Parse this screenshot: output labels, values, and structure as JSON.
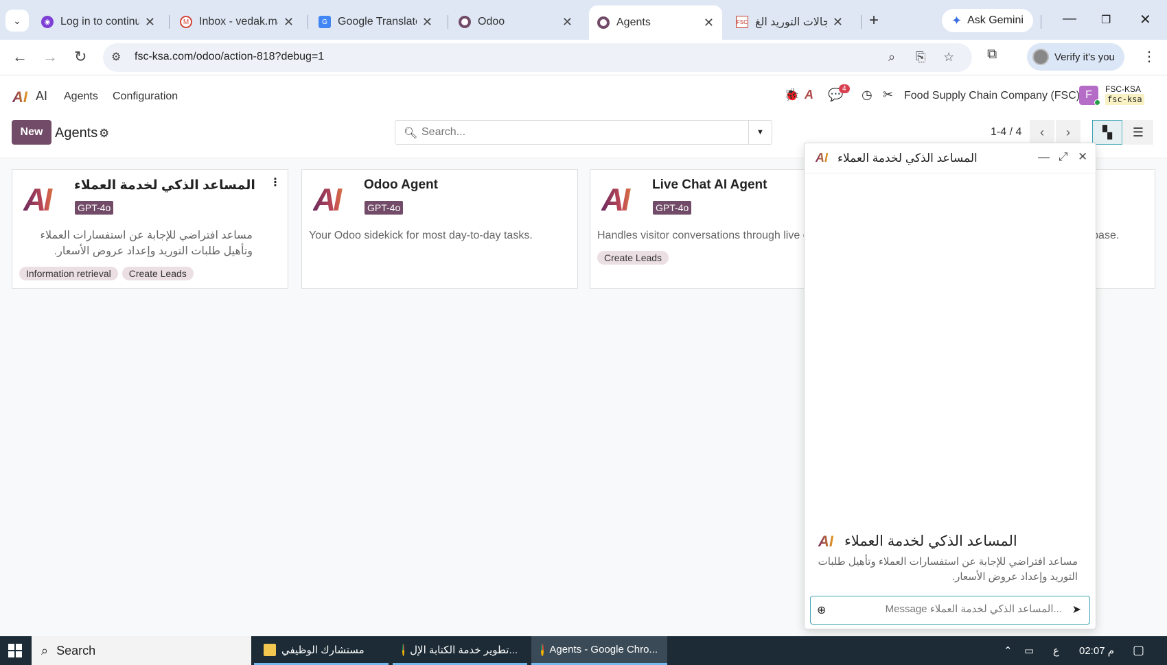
{
  "browser": {
    "tabs": [
      {
        "label": "Log in to continu",
        "icon": "security-icon",
        "color": "#7e3fd6"
      },
      {
        "label": "Inbox - vedak.ma",
        "icon": "mail-icon",
        "color": "#d44638"
      },
      {
        "label": "Google Translate",
        "icon": "translate-icon",
        "color": "#4285f4"
      },
      {
        "label": "Odoo",
        "icon": "odoo-icon",
        "color": "#714b67"
      },
      {
        "label": "Agents",
        "icon": "odoo-icon",
        "color": "#714b67"
      },
      {
        "label": "مجالات التوريد الغ",
        "icon": "page-icon",
        "color": "#c0392b"
      }
    ],
    "gemini_label": "Ask Gemini",
    "url": "fsc-ksa.com/odoo/action-818?debug=1",
    "verify_label": "Verify it's you"
  },
  "odoo": {
    "app_logo": "AI",
    "app_name": "AI",
    "menu": [
      "Agents",
      "Configuration"
    ],
    "message_count": "4",
    "company": "Food Supply Chain Company (FSC)",
    "user_initial": "F",
    "db_name": "FSC-KSA",
    "db_code": "fsc-ksa"
  },
  "control_panel": {
    "new_label": "New",
    "title": "Agents",
    "search_placeholder": "Search...",
    "pager": "1-4 / 4"
  },
  "agents": [
    {
      "name": "المساعد الذكي لخدمة العملاء",
      "model": "GPT-4o",
      "description": "مساعد افتراضي للإجابة عن استفسارات العملاء وتأهيل طلبات التوريد وإعداد عروض الأسعار.",
      "tags": [
        "Information retrieval",
        "Create Leads"
      ]
    },
    {
      "name": "Odoo Agent",
      "model": "GPT-4o",
      "description": "Your Odoo sidekick for most day-to-day tasks.",
      "tags": []
    },
    {
      "name": "Live Chat AI Agent",
      "model": "GPT-4o",
      "description": "Handles visitor conversations through live c",
      "tags": [
        "Create Leads"
      ]
    },
    {
      "name": "",
      "model": "",
      "description": "database.",
      "tags": []
    }
  ],
  "chat": {
    "title": "المساعد الذكي لخدمة العملاء",
    "intro_title": "المساعد الذكي لخدمة العملاء",
    "intro_desc": "مساعد افتراضي للإجابة عن استفسارات العملاء وتأهيل طلبات التوريد وإعداد عروض الأسعار.",
    "input_placeholder": "Message المساعد الذكي لخدمة العملاء..."
  },
  "taskbar": {
    "search_label": "Search",
    "apps": [
      "مستشارك الوظيفي",
      "تطوير خدمة الكتابة الإل...",
      "Agents - Google Chro..."
    ],
    "lang": "ع",
    "time": "م 02:07"
  }
}
